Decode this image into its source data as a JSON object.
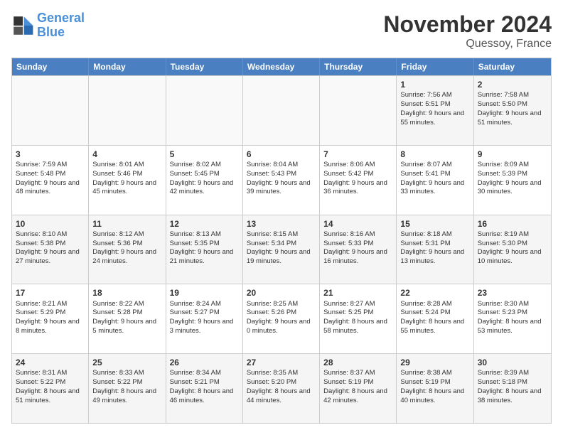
{
  "logo": {
    "line1": "General",
    "line2": "Blue"
  },
  "title": "November 2024",
  "subtitle": "Quessoy, France",
  "header_days": [
    "Sunday",
    "Monday",
    "Tuesday",
    "Wednesday",
    "Thursday",
    "Friday",
    "Saturday"
  ],
  "rows": [
    [
      {
        "day": "",
        "info": "",
        "empty": true
      },
      {
        "day": "",
        "info": "",
        "empty": true
      },
      {
        "day": "",
        "info": "",
        "empty": true
      },
      {
        "day": "",
        "info": "",
        "empty": true
      },
      {
        "day": "",
        "info": "",
        "empty": true
      },
      {
        "day": "1",
        "info": "Sunrise: 7:56 AM\nSunset: 5:51 PM\nDaylight: 9 hours and 55 minutes."
      },
      {
        "day": "2",
        "info": "Sunrise: 7:58 AM\nSunset: 5:50 PM\nDaylight: 9 hours and 51 minutes."
      }
    ],
    [
      {
        "day": "3",
        "info": "Sunrise: 7:59 AM\nSunset: 5:48 PM\nDaylight: 9 hours and 48 minutes."
      },
      {
        "day": "4",
        "info": "Sunrise: 8:01 AM\nSunset: 5:46 PM\nDaylight: 9 hours and 45 minutes."
      },
      {
        "day": "5",
        "info": "Sunrise: 8:02 AM\nSunset: 5:45 PM\nDaylight: 9 hours and 42 minutes."
      },
      {
        "day": "6",
        "info": "Sunrise: 8:04 AM\nSunset: 5:43 PM\nDaylight: 9 hours and 39 minutes."
      },
      {
        "day": "7",
        "info": "Sunrise: 8:06 AM\nSunset: 5:42 PM\nDaylight: 9 hours and 36 minutes."
      },
      {
        "day": "8",
        "info": "Sunrise: 8:07 AM\nSunset: 5:41 PM\nDaylight: 9 hours and 33 minutes."
      },
      {
        "day": "9",
        "info": "Sunrise: 8:09 AM\nSunset: 5:39 PM\nDaylight: 9 hours and 30 minutes."
      }
    ],
    [
      {
        "day": "10",
        "info": "Sunrise: 8:10 AM\nSunset: 5:38 PM\nDaylight: 9 hours and 27 minutes."
      },
      {
        "day": "11",
        "info": "Sunrise: 8:12 AM\nSunset: 5:36 PM\nDaylight: 9 hours and 24 minutes."
      },
      {
        "day": "12",
        "info": "Sunrise: 8:13 AM\nSunset: 5:35 PM\nDaylight: 9 hours and 21 minutes."
      },
      {
        "day": "13",
        "info": "Sunrise: 8:15 AM\nSunset: 5:34 PM\nDaylight: 9 hours and 19 minutes."
      },
      {
        "day": "14",
        "info": "Sunrise: 8:16 AM\nSunset: 5:33 PM\nDaylight: 9 hours and 16 minutes."
      },
      {
        "day": "15",
        "info": "Sunrise: 8:18 AM\nSunset: 5:31 PM\nDaylight: 9 hours and 13 minutes."
      },
      {
        "day": "16",
        "info": "Sunrise: 8:19 AM\nSunset: 5:30 PM\nDaylight: 9 hours and 10 minutes."
      }
    ],
    [
      {
        "day": "17",
        "info": "Sunrise: 8:21 AM\nSunset: 5:29 PM\nDaylight: 9 hours and 8 minutes."
      },
      {
        "day": "18",
        "info": "Sunrise: 8:22 AM\nSunset: 5:28 PM\nDaylight: 9 hours and 5 minutes."
      },
      {
        "day": "19",
        "info": "Sunrise: 8:24 AM\nSunset: 5:27 PM\nDaylight: 9 hours and 3 minutes."
      },
      {
        "day": "20",
        "info": "Sunrise: 8:25 AM\nSunset: 5:26 PM\nDaylight: 9 hours and 0 minutes."
      },
      {
        "day": "21",
        "info": "Sunrise: 8:27 AM\nSunset: 5:25 PM\nDaylight: 8 hours and 58 minutes."
      },
      {
        "day": "22",
        "info": "Sunrise: 8:28 AM\nSunset: 5:24 PM\nDaylight: 8 hours and 55 minutes."
      },
      {
        "day": "23",
        "info": "Sunrise: 8:30 AM\nSunset: 5:23 PM\nDaylight: 8 hours and 53 minutes."
      }
    ],
    [
      {
        "day": "24",
        "info": "Sunrise: 8:31 AM\nSunset: 5:22 PM\nDaylight: 8 hours and 51 minutes."
      },
      {
        "day": "25",
        "info": "Sunrise: 8:33 AM\nSunset: 5:22 PM\nDaylight: 8 hours and 49 minutes."
      },
      {
        "day": "26",
        "info": "Sunrise: 8:34 AM\nSunset: 5:21 PM\nDaylight: 8 hours and 46 minutes."
      },
      {
        "day": "27",
        "info": "Sunrise: 8:35 AM\nSunset: 5:20 PM\nDaylight: 8 hours and 44 minutes."
      },
      {
        "day": "28",
        "info": "Sunrise: 8:37 AM\nSunset: 5:19 PM\nDaylight: 8 hours and 42 minutes."
      },
      {
        "day": "29",
        "info": "Sunrise: 8:38 AM\nSunset: 5:19 PM\nDaylight: 8 hours and 40 minutes."
      },
      {
        "day": "30",
        "info": "Sunrise: 8:39 AM\nSunset: 5:18 PM\nDaylight: 8 hours and 38 minutes."
      }
    ]
  ]
}
